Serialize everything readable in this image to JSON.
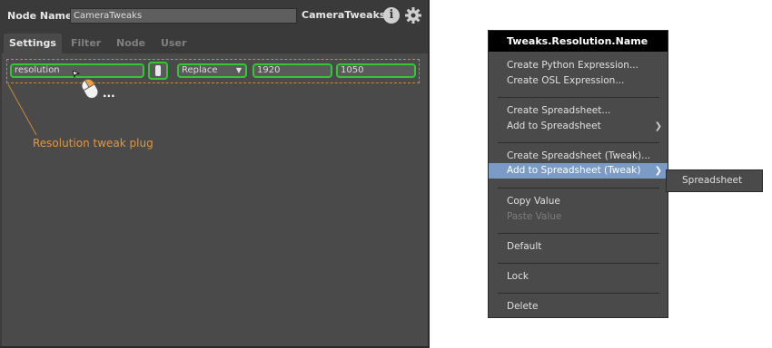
{
  "node_editor": {
    "node_name_label": "Node Name",
    "node_name_value": "CameraTweaks",
    "node_type": "CameraTweaks",
    "info_glyph": "i",
    "tabs": [
      {
        "label": "Settings",
        "active": true
      },
      {
        "label": "Filter",
        "active": false
      },
      {
        "label": "Node",
        "active": false
      },
      {
        "label": "User",
        "active": false
      }
    ],
    "plug": {
      "name": "resolution",
      "enabled": true,
      "mode": "Replace",
      "value_x": "1920",
      "value_y": "1050"
    },
    "ellipsis": "...",
    "annotation": "Resolution tweak plug",
    "colors": {
      "highlight_border": "#33c833",
      "dashed_outline": "#c8873a",
      "annotation": "#e3963b"
    }
  },
  "context_menu": {
    "title": "Tweaks.Resolution.Name",
    "items": {
      "create_python_expression": "Create Python Expression...",
      "create_osl_expression": "Create OSL Expression...",
      "create_spreadsheet": "Create Spreadsheet...",
      "add_to_spreadsheet": "Add to Spreadsheet",
      "create_spreadsheet_tweak": "Create Spreadsheet (Tweak)...",
      "add_to_spreadsheet_tweak": "Add to Spreadsheet (Tweak)",
      "copy_value": "Copy Value",
      "paste_value": "Paste Value",
      "default": "Default",
      "lock": "Lock",
      "delete": "Delete"
    },
    "submenu_arrow": "❯",
    "highlight_color": "#7a9cc4",
    "submenu": {
      "item": "Spreadsheet"
    }
  }
}
